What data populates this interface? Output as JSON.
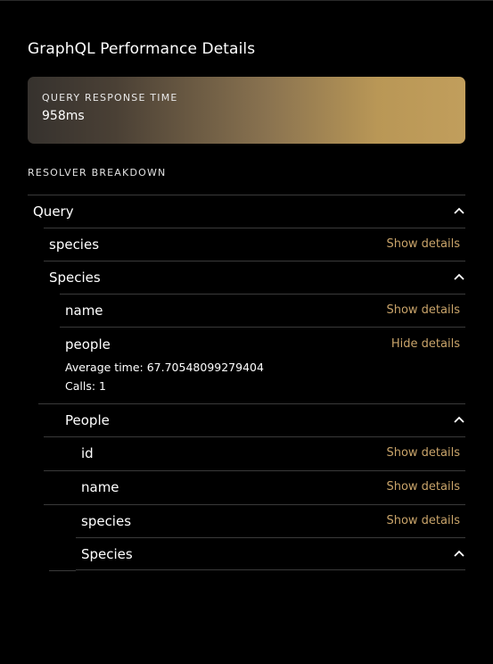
{
  "panel": {
    "title": "GraphQL Performance Details",
    "response_card": {
      "label": "QUERY RESPONSE TIME",
      "value": "958ms"
    },
    "breakdown_label": "RESOLVER BREAKDOWN"
  },
  "resolvers": {
    "query": {
      "label": "Query"
    },
    "species": {
      "label": "species",
      "action": "Show details"
    },
    "species_type": {
      "label": "Species"
    },
    "name": {
      "label": "name",
      "action": "Show details"
    },
    "people": {
      "label": "people",
      "action": "Hide details",
      "average_time": "Average time: 67.70548099279404",
      "calls": "Calls: 1"
    },
    "people_type": {
      "label": "People"
    },
    "id": {
      "label": "id",
      "action": "Show details"
    },
    "people_name": {
      "label": "name",
      "action": "Show details"
    },
    "people_species": {
      "label": "species",
      "action": "Show details"
    },
    "people_species_type": {
      "label": "Species"
    }
  },
  "colors": {
    "accent": "#c9a46a",
    "background": "#000000",
    "divider": "#3a3a3a"
  }
}
